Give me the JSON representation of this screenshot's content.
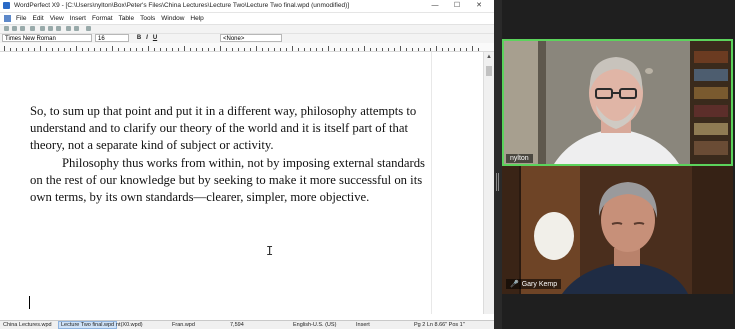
{
  "window": {
    "title": "WordPerfect X9 - [C:\\Users\\nylton\\Box\\Peter's Files\\China Lectures\\Lecture Two\\Lecture Two final.wpd (unmodified)]",
    "minimize": "—",
    "maximize": "☐",
    "close": "✕"
  },
  "menu": [
    "File",
    "Edit",
    "View",
    "Insert",
    "Format",
    "Table",
    "Tools",
    "Window",
    "Help"
  ],
  "property_bar": {
    "font": "Times New Roman",
    "size": "16",
    "style": "<None>",
    "bold": "B",
    "italic": "I",
    "underline": "U"
  },
  "document": {
    "paragraph1": "So, to sum up that point and put it in a different way, philosophy attempts to understand and to clarify our theory of the world and it is itself part of that theory, not a separate kind of subject or activity.",
    "paragraph2": "Philosophy thus works from within, not by imposing external standards on the rest of our knowledge but by seeking to make it more successful on its own terms, by its own standards—clearer, simpler, more objective."
  },
  "statusbar": {
    "tabs": [
      "China Lectures.wpd",
      "Lecture Two final.wpd",
      "nt(X0.wpd)",
      "Fran.wpd"
    ],
    "count": "7,594",
    "language": "English-U.S. (US)",
    "mode": "Insert",
    "position": "Pg 2 Ln 8.66\" Pos 1\""
  },
  "participants": [
    {
      "name": "nylton",
      "muted": false
    },
    {
      "name": "Gary Kemp",
      "muted": true
    }
  ],
  "colors": {
    "active_speaker_border": "#5cd35c",
    "muted_icon": "#ff4a4a"
  }
}
